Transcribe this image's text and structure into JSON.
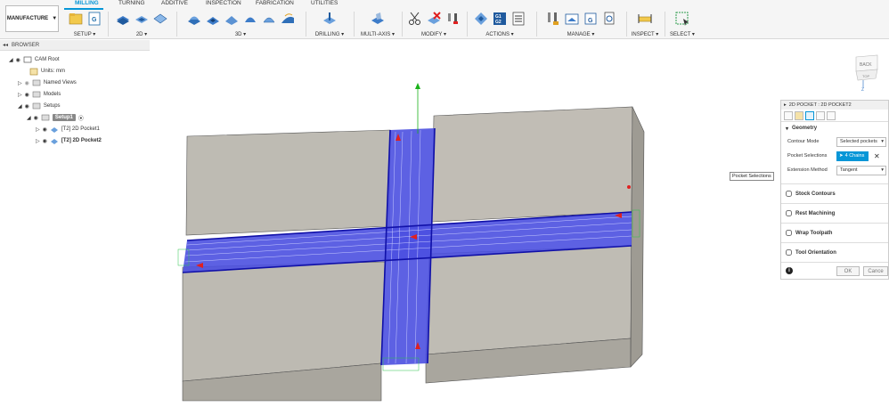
{
  "workspace": {
    "label": "MANUFACTURE",
    "arrow": "▼"
  },
  "tabs": [
    "MILLING",
    "TURNING",
    "ADDITIVE",
    "INSPECTION",
    "FABRICATION",
    "UTILITIES"
  ],
  "groups": {
    "setup": "SETUP ▾",
    "two_d": "2D ▾",
    "three_d": "3D ▾",
    "drilling": "DRILLING ▾",
    "multi_axis": "MULTI-AXIS ▾",
    "modify": "MODIFY ▾",
    "actions": "ACTIONS ▾",
    "manage": "MANAGE ▾",
    "inspect": "INSPECT ▾",
    "select": "SELECT ▾"
  },
  "ribbon_icon_glyphs": {
    "g_code": "G",
    "g1": "G1",
    "g2": "G2",
    "g_doc": "G"
  },
  "browser": {
    "title": "BROWSER",
    "items": [
      {
        "label": "CAM Root"
      },
      {
        "label": "Units: mm"
      },
      {
        "label": "Named Views"
      },
      {
        "label": "Models"
      },
      {
        "label": "Setups"
      },
      {
        "label": "Setup1"
      },
      {
        "label": "[T2] 2D Pocket1"
      },
      {
        "label": "[T2] 2D Pocket2"
      }
    ]
  },
  "panel": {
    "title": "2D POCKET : 2D POCKET2",
    "geometry_title": "Geometry",
    "contour_mode_label": "Contour Mode",
    "contour_mode_value": "Selected pockets",
    "pocket_selections_label": "Pocket Selections",
    "chains_value": "4 Chains",
    "clear_glyph": "✕",
    "extension_method_label": "Extension Method",
    "extension_method_value": "Tangent",
    "dropdown_arrow": "▾",
    "sections": [
      "Stock Contours",
      "Rest Machining",
      "Wrap Toolpath",
      "Tool Orientation"
    ],
    "info_glyph": "i",
    "ok_label": "OK",
    "cancel_label": "Cance"
  },
  "tooltip": "Pocket Selections",
  "viewcube": {
    "faces": [
      "BACK",
      "TOP"
    ],
    "z_label": "Z"
  },
  "colors": {
    "accent": "#0696d7",
    "stock": "#bdbab2",
    "toolpath": "#3a3fd8",
    "arrow": "#e02020",
    "axis_green": "#1ab21a"
  }
}
